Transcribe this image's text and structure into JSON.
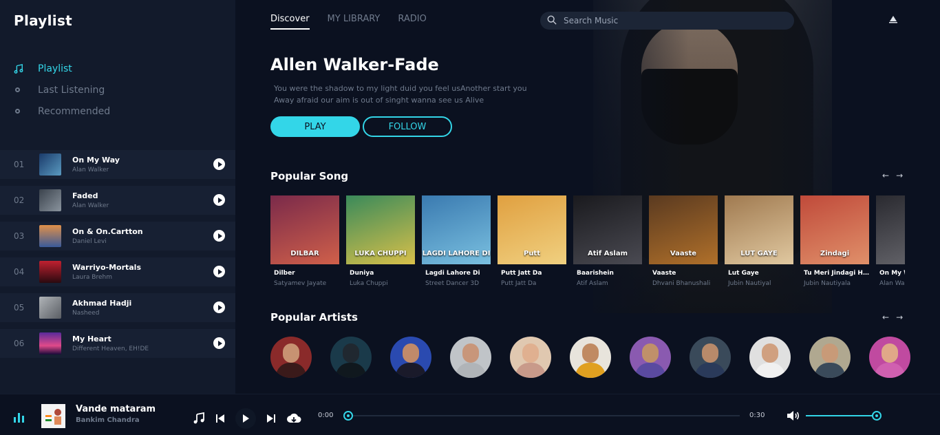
{
  "app": {
    "title": "Playlist"
  },
  "sidebar": {
    "nav": [
      {
        "label": "Playlist",
        "active": true,
        "icon": "music-note-icon"
      },
      {
        "label": "Last Listening",
        "active": false,
        "icon": "dot-icon"
      },
      {
        "label": "Recommended",
        "active": false,
        "icon": "dot-icon"
      }
    ],
    "tracks": [
      {
        "num": "01",
        "title": "On My Way",
        "artist": "Alan Walker",
        "color": "#2f5b8a"
      },
      {
        "num": "02",
        "title": "Faded",
        "artist": "Alan Walker",
        "color": "#5a6470"
      },
      {
        "num": "03",
        "title": "On & On.Cartton",
        "artist": "Daniel Levi",
        "color": "#c06a3a"
      },
      {
        "num": "04",
        "title": "Warriyo-Mortals",
        "artist": "Laura Brehm",
        "color": "#7a1620"
      },
      {
        "num": "05",
        "title": "Akhmad Hadji",
        "artist": "Nasheed",
        "color": "#8a8f96"
      },
      {
        "num": "06",
        "title": "My Heart",
        "artist": "Different Heaven, EH!DE",
        "color": "#8a3fbf"
      }
    ]
  },
  "header": {
    "tabs": [
      {
        "label": "Discover",
        "active": true
      },
      {
        "label": "MY LIBRARY",
        "active": false
      },
      {
        "label": "RADIO",
        "active": false
      }
    ],
    "search_placeholder": "Search Music"
  },
  "hero": {
    "title": "Allen Walker-Fade",
    "desc_line1": "You were the shadow to my light duid you feel usAnother start you",
    "desc_line2": "Away afraid our aim is out of singht wanna see us Alive",
    "play_label": "PLAY",
    "follow_label": "FOLLOW"
  },
  "popular_songs": {
    "title": "Popular Song",
    "items": [
      {
        "title": "Dilber",
        "artist": "Satyamev Jayate",
        "cover_text": "DILBAR",
        "color1": "#7a2a4a",
        "color2": "#d0604a"
      },
      {
        "title": "Duniya",
        "artist": "Luka Chuppi",
        "cover_text": "LUKA CHUPPI",
        "color1": "#3a8a5a",
        "color2": "#d8c04a"
      },
      {
        "title": "Lagdi Lahore Di",
        "artist": "Street Dancer 3D",
        "cover_text": "LAGDI LAHORE DI",
        "color1": "#3a7ab0",
        "color2": "#7ac0e0"
      },
      {
        "title": "Putt Jatt Da",
        "artist": "Putt Jatt Da",
        "cover_text": "Putt",
        "color1": "#e0a040",
        "color2": "#f0d080"
      },
      {
        "title": "Baarishein",
        "artist": "Atif Aslam",
        "cover_text": "Atif Aslam",
        "color1": "#1a1a1e",
        "color2": "#4a4a52"
      },
      {
        "title": "Vaaste",
        "artist": "Dhvani Bhanushali",
        "cover_text": "Vaaste",
        "color1": "#5a3a20",
        "color2": "#b0702a"
      },
      {
        "title": "Lut Gaye",
        "artist": "Jubin Nautiyal",
        "cover_text": "LUT GAYE",
        "color1": "#a07a50",
        "color2": "#e0c8a0"
      },
      {
        "title": "Tu Meri Jindagi Hai",
        "artist": "Jubin Nautiyala",
        "cover_text": "Zindagi",
        "color1": "#c04a3a",
        "color2": "#e0906a"
      },
      {
        "title": "On My Way",
        "artist": "Alan Walker",
        "cover_text": "",
        "color1": "#2a2a30",
        "color2": "#6a6a70"
      }
    ]
  },
  "popular_artists": {
    "title": "Popular Artists",
    "items": [
      {
        "name": "artist-1",
        "bg": "#8a2a2a",
        "skin": "#c79272",
        "cloth": "#3a1a1a"
      },
      {
        "name": "artist-2",
        "bg": "#1a3a4a",
        "skin": "#202830",
        "cloth": "#10181e"
      },
      {
        "name": "artist-3",
        "bg": "#2a4ab0",
        "skin": "#c08a6a",
        "cloth": "#1a1a2a"
      },
      {
        "name": "artist-4",
        "bg": "#c0c4c8",
        "skin": "#c8967a",
        "cloth": "#b0b4b8"
      },
      {
        "name": "artist-5",
        "bg": "#e0c8b0",
        "skin": "#e0b090",
        "cloth": "#c89a8a"
      },
      {
        "name": "artist-6",
        "bg": "#e8e4dc",
        "skin": "#c08a62",
        "cloth": "#e0a020"
      },
      {
        "name": "artist-7",
        "bg": "#8a5ab0",
        "skin": "#c0906a",
        "cloth": "#5a4aa0"
      },
      {
        "name": "artist-8",
        "bg": "#3a4a5a",
        "skin": "#b88a6a",
        "cloth": "#2a3a5a"
      },
      {
        "name": "artist-9",
        "bg": "#e0e0e0",
        "skin": "#d0a080",
        "cloth": "#f0f0f0"
      },
      {
        "name": "artist-10",
        "bg": "#b0a890",
        "skin": "#c89a78",
        "cloth": "#3a4a5a"
      },
      {
        "name": "artist-11",
        "bg": "#c04aa0",
        "skin": "#e0a888",
        "cloth": "#d060b0"
      }
    ]
  },
  "player": {
    "title": "Vande mataram",
    "artist": "Bankim Chandra",
    "time_current": "0:00",
    "time_total": "0:30",
    "progress": 0,
    "volume": 1
  },
  "colors": {
    "accent": "#33d6e8",
    "bg": "#0b1120",
    "sidebar": "#121a2b",
    "muted": "#6f7a8c"
  }
}
